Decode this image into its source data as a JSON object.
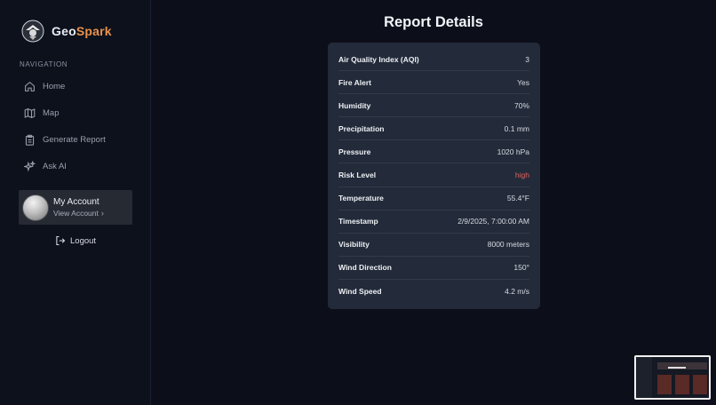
{
  "brand": {
    "name_part1": "Geo",
    "name_part2": "Spark"
  },
  "sidebar": {
    "heading": "NAVIGATION",
    "items": [
      {
        "label": "Home",
        "icon": "home-icon"
      },
      {
        "label": "Map",
        "icon": "map-icon"
      },
      {
        "label": "Generate Report",
        "icon": "clipboard-icon"
      },
      {
        "label": "Ask AI",
        "icon": "sparkle-icon"
      }
    ],
    "account": {
      "title": "My Account",
      "link": "View Account",
      "link_icon": "chevron-right-icon"
    },
    "logout": {
      "label": "Logout",
      "icon": "logout-icon"
    }
  },
  "main": {
    "title": "Report Details",
    "rows": [
      {
        "key": "Air Quality Index (AQI)",
        "value": "3"
      },
      {
        "key": "Fire Alert",
        "value": "Yes"
      },
      {
        "key": "Humidity",
        "value": "70%"
      },
      {
        "key": "Precipitation",
        "value": "0.1 mm"
      },
      {
        "key": "Pressure",
        "value": "1020 hPa"
      },
      {
        "key": "Risk Level",
        "value": "high"
      },
      {
        "key": "Temperature",
        "value": "55.4°F"
      },
      {
        "key": "Timestamp",
        "value": "2/9/2025, 7:00:00 AM"
      },
      {
        "key": "Visibility",
        "value": "8000 meters"
      },
      {
        "key": "Wind Direction",
        "value": "150°"
      },
      {
        "key": "Wind Speed",
        "value": "4.2 m/s"
      }
    ]
  },
  "colors": {
    "background": "#0c0f1a",
    "card": "#232b3a",
    "brand_accent": "#e8934a",
    "risk_high": "#e0625d"
  }
}
